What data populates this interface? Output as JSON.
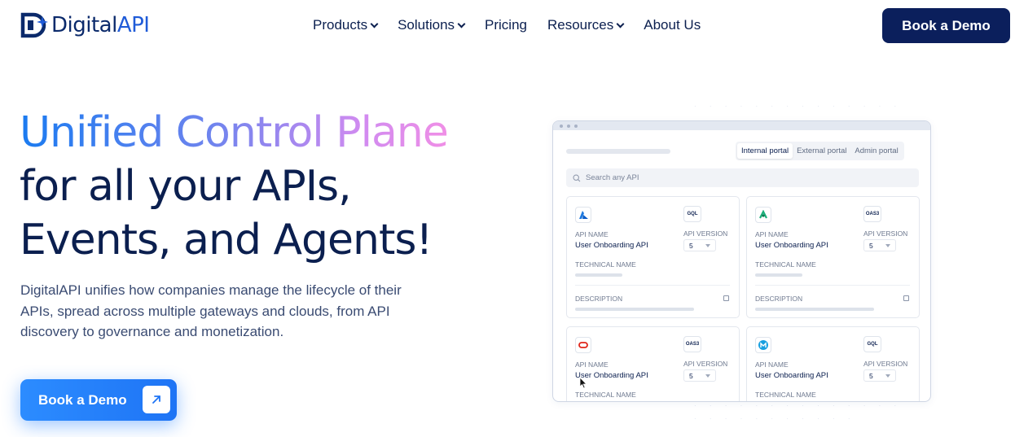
{
  "brand": {
    "name_part1": "Digital",
    "name_part2": "API",
    "accent": "#1f5bd8",
    "navy": "#0b1f5c"
  },
  "nav": {
    "items": [
      {
        "label": "Products",
        "has_dropdown": true
      },
      {
        "label": "Solutions",
        "has_dropdown": true
      },
      {
        "label": "Pricing",
        "has_dropdown": false
      },
      {
        "label": "Resources",
        "has_dropdown": true
      },
      {
        "label": "About Us",
        "has_dropdown": false
      }
    ],
    "cta_label": "Book a Demo"
  },
  "hero": {
    "headline_gradient": "Unified Control Plane",
    "headline_line2": "for all your APIs,",
    "headline_line3": "Events, and Agents!",
    "subtext": "DigitalAPI unifies how companies manage the lifecycle of their APIs, spread across multiple gateways and clouds, from API discovery to governance and monetization.",
    "cta_label": "Book a Demo",
    "cta_icon": "arrow-up-right-icon"
  },
  "mock": {
    "tabs": [
      {
        "label": "Internal portal",
        "active": true
      },
      {
        "label": "External portal",
        "active": false
      },
      {
        "label": "Admin portal",
        "active": false
      }
    ],
    "search_placeholder": "Search any API",
    "labels": {
      "api_name": "API NAME",
      "api_version": "API VERSION",
      "technical_name": "TECHNICAL NAME",
      "description": "DESCRIPTION"
    },
    "cards": [
      {
        "icon": "azure-icon",
        "badge": "GQL",
        "api_name": "User Onboarding API",
        "version": "5"
      },
      {
        "icon": "apigee-icon",
        "badge": "OAS3",
        "api_name": "User Onboarding API",
        "version": "5"
      },
      {
        "icon": "oracle-icon",
        "badge": "OAS3",
        "api_name": "User Onboarding API",
        "version": "5"
      },
      {
        "icon": "mulesoft-icon",
        "badge": "GQL",
        "api_name": "User Onboarding API",
        "version": "5"
      }
    ]
  }
}
